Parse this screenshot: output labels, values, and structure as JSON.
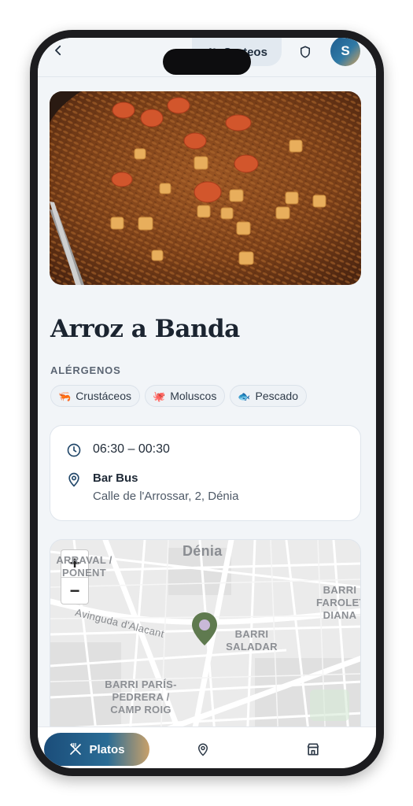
{
  "header": {
    "sorteos_label": "Sorteos",
    "avatar_initial": "S"
  },
  "dish": {
    "title": "Arroz a Banda",
    "image_alt": "Arroz a banda con gambas"
  },
  "allergens": {
    "heading": "ALÉRGENOS",
    "items": [
      {
        "label": "Crustáceos",
        "icon": "shrimp-icon",
        "glyph": "🦐"
      },
      {
        "label": "Moluscos",
        "icon": "octopus-icon",
        "glyph": "🐙"
      },
      {
        "label": "Pescado",
        "icon": "fish-icon",
        "glyph": "🐟"
      }
    ]
  },
  "info": {
    "hours": "06:30 – 00:30",
    "venue_name": "Bar Bus",
    "venue_address": "Calle de l'Arrossar, 2, Dénia"
  },
  "map": {
    "zoom_in": "+",
    "zoom_out": "−",
    "labels": {
      "city": "Dénia",
      "area_nw": "ARRAVAL / PONENT",
      "area_ne": "BARRI FAROLET DIANA",
      "street": "Avinguda d'Alacant",
      "area_center": "BARRI SALADAR",
      "area_sw": "BARRI PARÍS-PEDRERA / CAMP ROIG"
    }
  },
  "nav": {
    "active_label": "Platos"
  },
  "colors": {
    "accent_start": "#1b4d7a",
    "accent_end": "#c8a06a",
    "map_pin": "#5f7a4f"
  }
}
